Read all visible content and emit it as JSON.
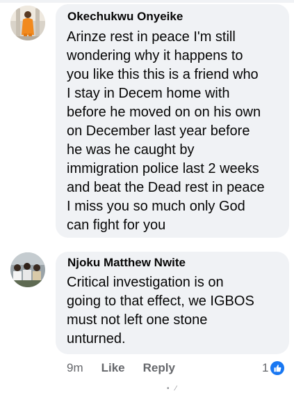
{
  "comments": [
    {
      "author": "Okechukwu Onyeike",
      "avatar_icon": "profile-photo-orange-outfit-avatar",
      "text": "Arinze rest in peace I'm still\nwondering why it happens to\nyou like this this is a friend who\nI stay in Decem home with\nbefore he moved on on his own\non December last year before\nhe was he caught by\nimmigration police last 2 weeks\nand beat the Dead rest in peace\nI miss you so much only God\ncan fight for you"
    },
    {
      "author": "Njoku Matthew Nwite",
      "avatar_icon": "profile-photo-group-avatar",
      "text": "Critical investigation is on\ngoing to that effect, we IGBOS\nmust not left one stone\nunturned.",
      "time": "9m",
      "like_label": "Like",
      "reply_label": "Reply",
      "reaction_count": "1",
      "reaction_icon": "thumbs-up-icon"
    }
  ],
  "colors": {
    "bubble": "#f0f2f5",
    "text": "#050505",
    "meta": "#65676b",
    "like_blue": "#1877f2"
  }
}
